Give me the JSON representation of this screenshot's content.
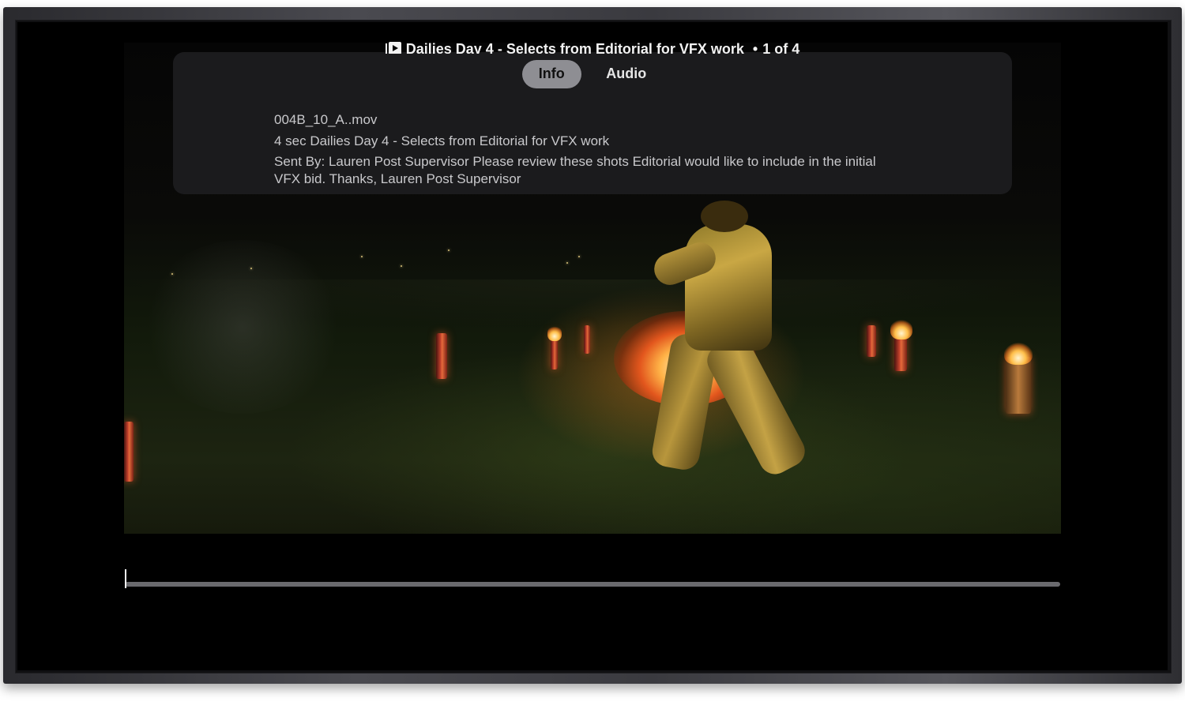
{
  "player": {
    "title": "Dailies Day 4 - Selects from Editorial for VFX work",
    "separator": "•",
    "position": "1 of 4"
  },
  "tabs": [
    {
      "label": "Info",
      "active": true
    },
    {
      "label": "Audio",
      "active": false
    }
  ],
  "info": {
    "filename": "004B_10_A..mov",
    "duration_and_title": "4 sec  Dailies Day 4 - Selects from Editorial for VFX work",
    "description_line1": "Sent By: Lauren Post Supervisor Please review these shots Editorial would like to include in the initial",
    "description_line2": "VFX bid.   Thanks,  Lauren Post Supervisor"
  },
  "playback": {
    "progress": 0.0
  },
  "colors": {
    "panel_bg": "#1c1c1e",
    "tab_active_bg": "#8e8e93",
    "track": "#6a6a6e",
    "text": "#c9c9cc"
  },
  "icons": {
    "title_icon": "video-playlist-icon"
  }
}
